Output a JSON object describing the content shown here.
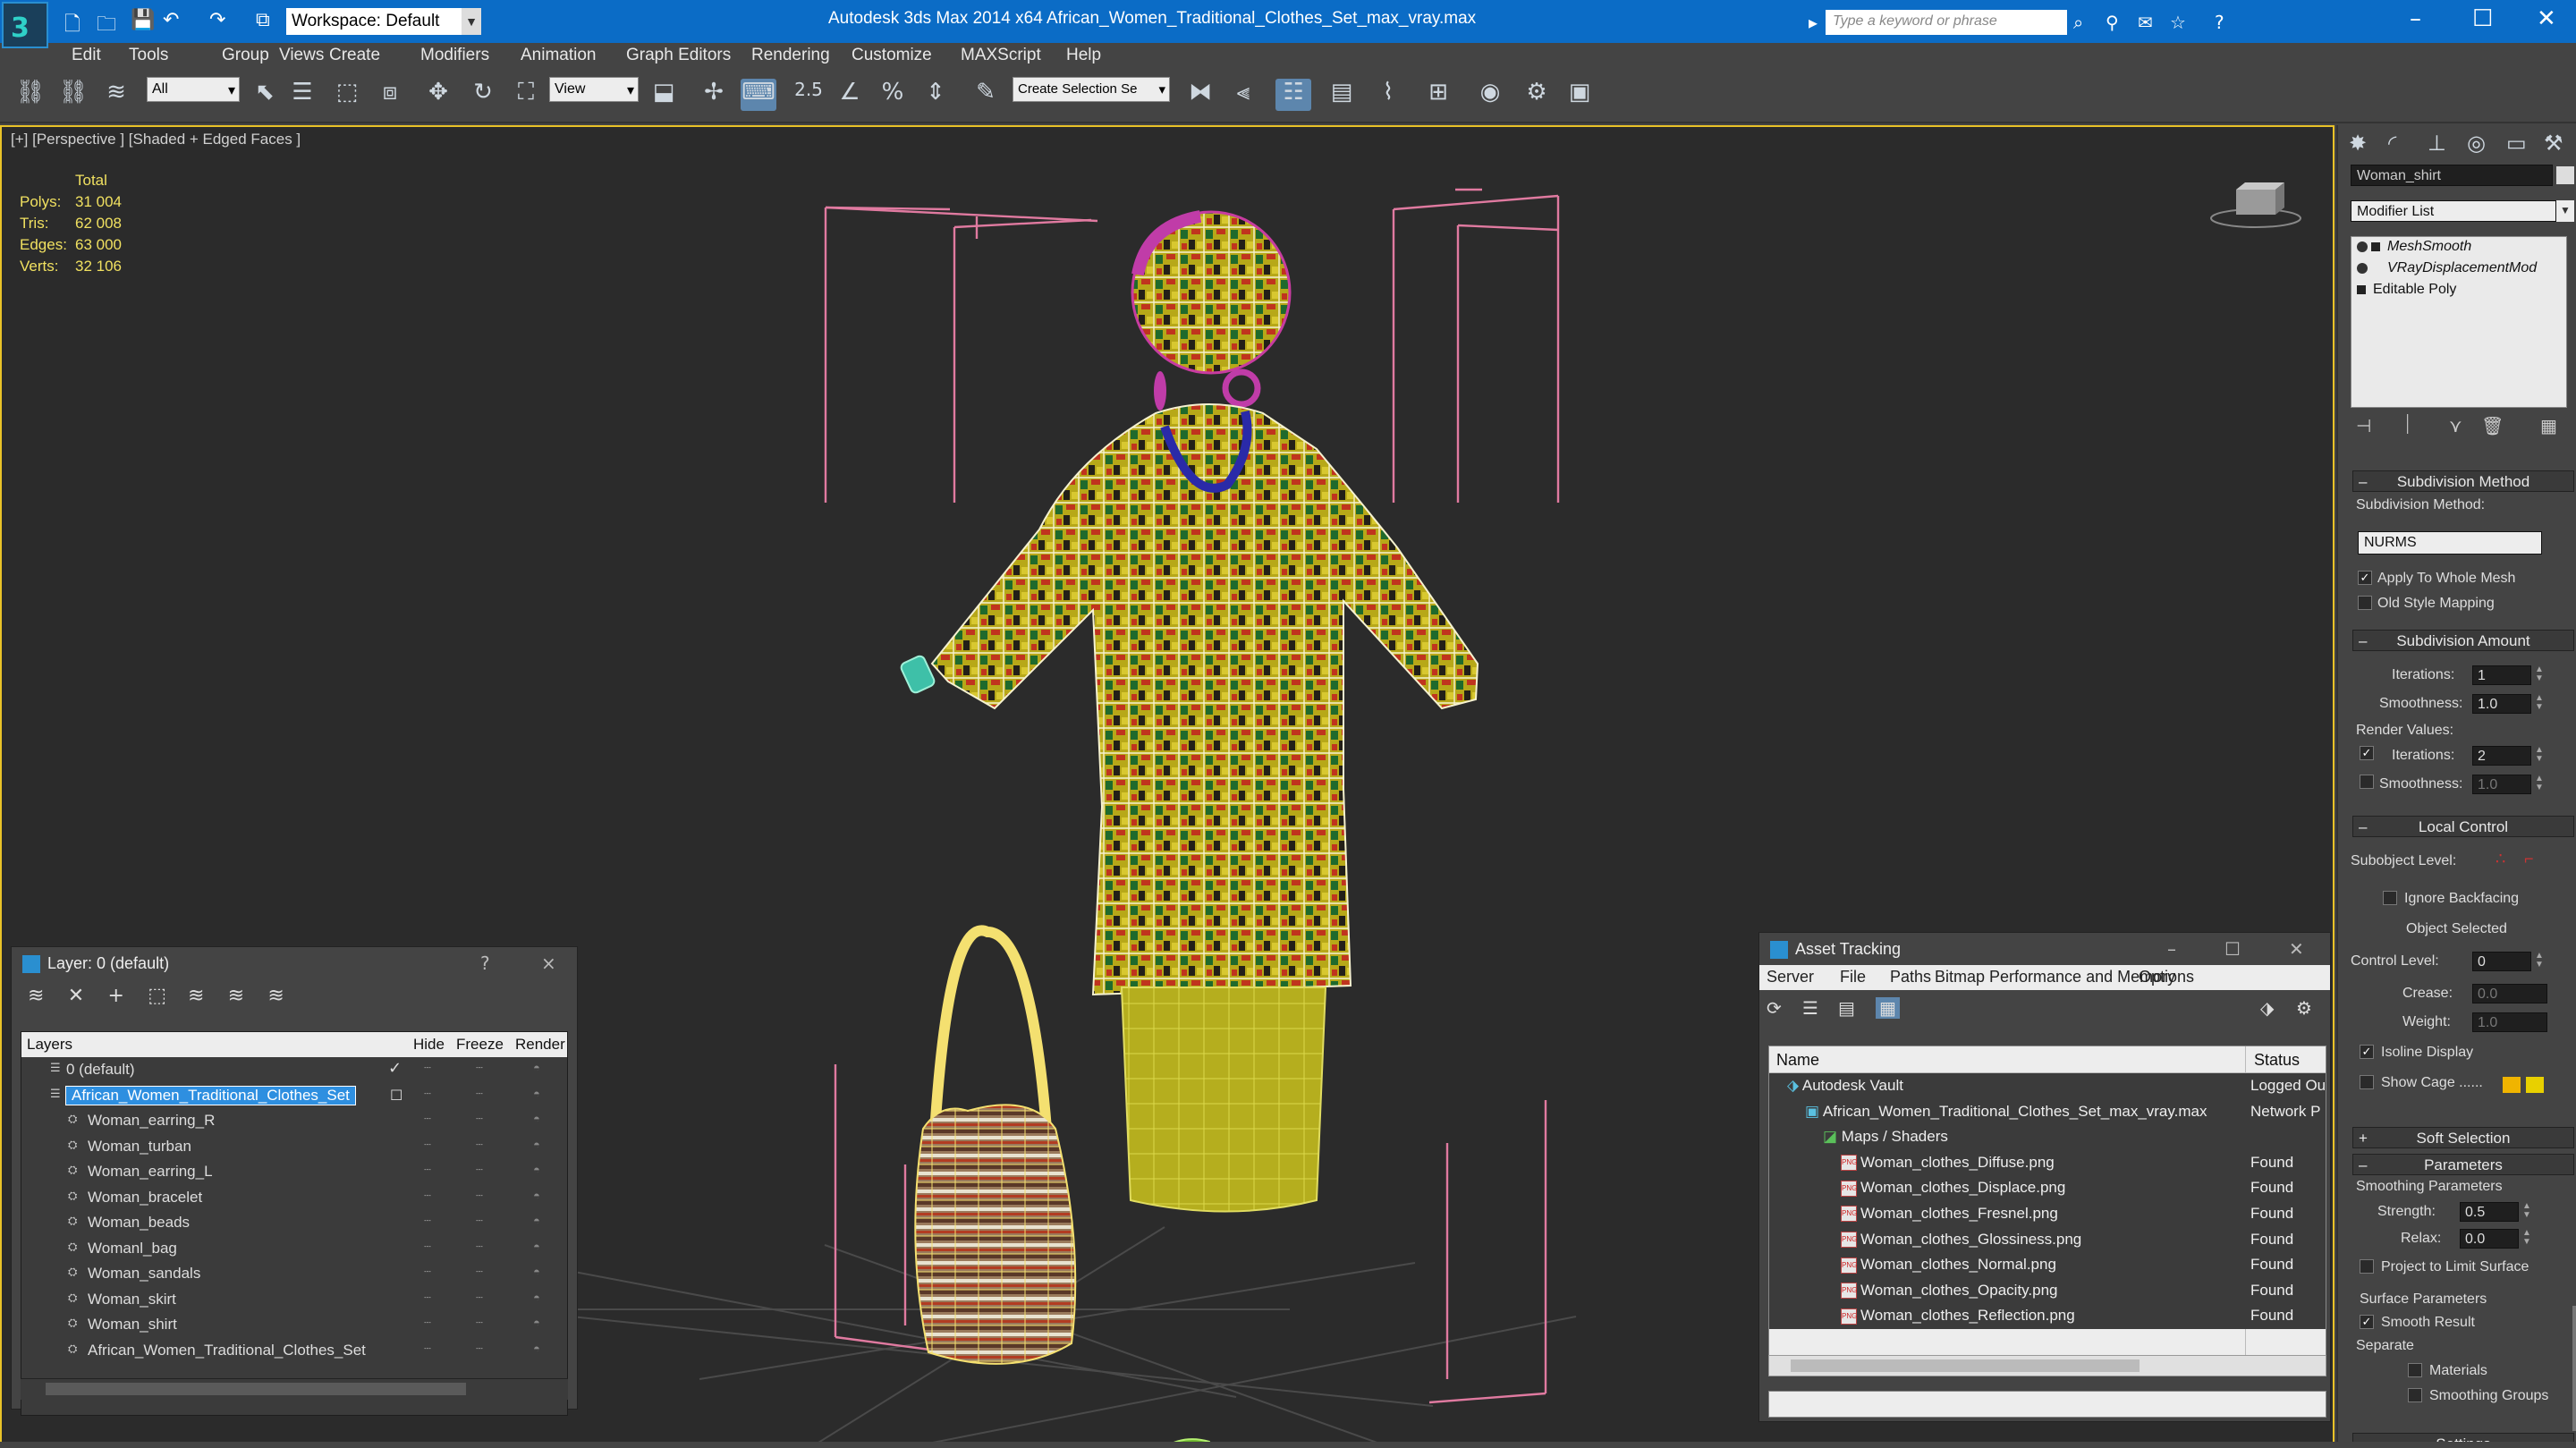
{
  "titlebar": {
    "workspace": "Workspace: Default",
    "app_title": "Autodesk 3ds Max  2014 x64      African_Women_Traditional_Clothes_Set_max_vray.max",
    "search_placeholder": "Type a keyword or phrase"
  },
  "menu": [
    "Edit",
    "Tools",
    "Group",
    "Views",
    "Create",
    "Modifiers",
    "Animation",
    "Graph Editors",
    "Rendering",
    "Customize",
    "MAXScript",
    "Help"
  ],
  "toolbar": {
    "selection_filter": "All",
    "reference_coord": "View",
    "snap_value": "2.5",
    "named_selection": "Create Selection Se"
  },
  "viewport": {
    "label": "[+] [Perspective ] [Shaded + Edged Faces ]",
    "stats_title": "Total",
    "stats": [
      {
        "label": "Polys:",
        "value": "31 004"
      },
      {
        "label": "Tris:",
        "value": "62 008"
      },
      {
        "label": "Edges:",
        "value": "63 000"
      },
      {
        "label": "Verts:",
        "value": "32 106"
      }
    ]
  },
  "layers_panel": {
    "title": "Layer: 0 (default)",
    "help": "?",
    "close": "×",
    "columns": [
      "Layers",
      "Hide",
      "Freeze",
      "Render"
    ],
    "rows": [
      {
        "name": "0 (default)",
        "level": 0,
        "check": "✓"
      },
      {
        "name": "African_Women_Traditional_Clothes_Set",
        "level": 0,
        "selected": true
      },
      {
        "name": "Woman_earring_R",
        "level": 1
      },
      {
        "name": "Woman_turban",
        "level": 1
      },
      {
        "name": "Woman_earring_L",
        "level": 1
      },
      {
        "name": "Woman_bracelet",
        "level": 1
      },
      {
        "name": "Woman_beads",
        "level": 1
      },
      {
        "name": "Womanl_bag",
        "level": 1
      },
      {
        "name": "Woman_sandals",
        "level": 1
      },
      {
        "name": "Woman_skirt",
        "level": 1
      },
      {
        "name": "Woman_shirt",
        "level": 1
      },
      {
        "name": "African_Women_Traditional_Clothes_Set",
        "level": 1
      }
    ]
  },
  "asset_panel": {
    "title": "Asset Tracking",
    "menu": [
      "Server",
      "File",
      "Paths",
      "Bitmap Performance and Memory",
      "Options"
    ],
    "columns": [
      "Name",
      "Status"
    ],
    "rows": [
      {
        "name": "Autodesk Vault",
        "status": "Logged Ou",
        "indent": 1,
        "type": "vault",
        "dark": true
      },
      {
        "name": "African_Women_Traditional_Clothes_Set_max_vray.max",
        "status": "Network P",
        "indent": 2,
        "type": "max",
        "dark": true
      },
      {
        "name": "Maps / Shaders",
        "status": "",
        "indent": 3,
        "type": "maps",
        "dark": true
      },
      {
        "name": "Woman_clothes_Diffuse.png",
        "status": "Found",
        "indent": 4,
        "type": "png",
        "dark": true
      },
      {
        "name": "Woman_clothes_Displace.png",
        "status": "Found",
        "indent": 4,
        "type": "png",
        "dark": true
      },
      {
        "name": "Woman_clothes_Fresnel.png",
        "status": "Found",
        "indent": 4,
        "type": "png",
        "dark": true
      },
      {
        "name": "Woman_clothes_Glossiness.png",
        "status": "Found",
        "indent": 4,
        "type": "png",
        "dark": true
      },
      {
        "name": "Woman_clothes_Normal.png",
        "status": "Found",
        "indent": 4,
        "type": "png",
        "dark": true
      },
      {
        "name": "Woman_clothes_Opacity.png",
        "status": "Found",
        "indent": 4,
        "type": "png",
        "dark": true
      },
      {
        "name": "Woman_clothes_Reflection.png",
        "status": "Found",
        "indent": 4,
        "type": "png",
        "dark": true
      }
    ]
  },
  "command_panel": {
    "object_name": "Woman_shirt",
    "modifier_list": "Modifier List",
    "stack": [
      "MeshSmooth",
      "VRayDisplacementMod",
      "Editable Poly"
    ],
    "subdivision_method_title": "Subdivision Method",
    "subdivision_method_label": "Subdivision Method:",
    "subdivision_method_value": "NURMS",
    "apply_whole_mesh": "Apply To Whole Mesh",
    "old_style_mapping": "Old Style Mapping",
    "subdivision_amount_title": "Subdivision Amount",
    "iterations_label": "Iterations:",
    "iterations_value": "1",
    "smoothness_label": "Smoothness:",
    "smoothness_value": "1.0",
    "render_values_label": "Render Values:",
    "render_iterations_label": "Iterations:",
    "render_iterations_value": "2",
    "render_smoothness_label": "Smoothness:",
    "render_smoothness_value": "1.0",
    "local_control_title": "Local Control",
    "subobject_level_label": "Subobject Level:",
    "ignore_backfacing": "Ignore Backfacing",
    "object_selected": "Object Selected",
    "control_level_label": "Control Level:",
    "control_level_value": "0",
    "crease_label": "Crease:",
    "crease_value": "0.0",
    "weight_label": "Weight:",
    "weight_value": "1.0",
    "isoline_display": "Isoline Display",
    "show_cage": "Show Cage ......",
    "soft_selection_title": "Soft Selection",
    "parameters_title": "Parameters",
    "smoothing_parameters": "Smoothing Parameters",
    "strength_label": "Strength:",
    "strength_value": "0.5",
    "relax_label": "Relax:",
    "relax_value": "0.0",
    "project_limit": "Project to Limit Surface",
    "surface_parameters": "Surface Parameters",
    "smooth_result": "Smooth Result",
    "separate": "Separate",
    "materials": "Materials",
    "smoothing_groups": "Smoothing Groups",
    "settings_title": "Settings"
  },
  "colors": {
    "title_blue": "#0b6cc6",
    "viewport_border": "#e9c228",
    "selection_blue": "#2e8fe0",
    "stats_yellow": "#f0e060",
    "bbox_pink": "#e07aa0"
  }
}
